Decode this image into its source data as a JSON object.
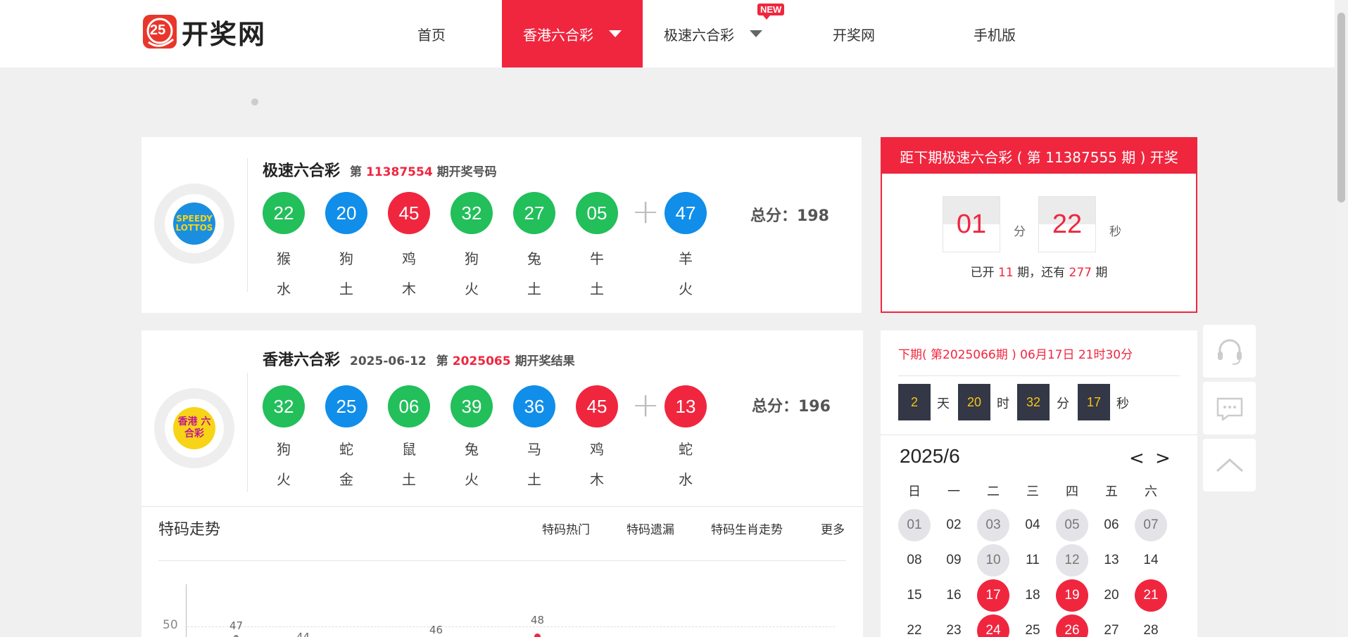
{
  "header": {
    "logo_text": "开奖网",
    "logo_mark": "25",
    "nav": [
      {
        "label": "首页"
      },
      {
        "label": "香港六合彩"
      },
      {
        "label": "极速六合彩"
      },
      {
        "label": "开奖网"
      },
      {
        "label": "手机版"
      }
    ],
    "new_badge": "NEW"
  },
  "speedy": {
    "name": "极速六合彩",
    "prefix": "第",
    "issue": "11387554",
    "suffix": "期开奖号码",
    "logo_text": "SPEEDY LOTTOS",
    "balls": [
      {
        "num": "22",
        "color": "green",
        "zodiac": "猴",
        "element": "水"
      },
      {
        "num": "20",
        "color": "blue",
        "zodiac": "狗",
        "element": "土"
      },
      {
        "num": "45",
        "color": "red",
        "zodiac": "鸡",
        "element": "木"
      },
      {
        "num": "32",
        "color": "green",
        "zodiac": "狗",
        "element": "火"
      },
      {
        "num": "27",
        "color": "green",
        "zodiac": "兔",
        "element": "土"
      },
      {
        "num": "05",
        "color": "green",
        "zodiac": "牛",
        "element": "土"
      }
    ],
    "special": {
      "num": "47",
      "color": "blue",
      "zodiac": "羊",
      "element": "火"
    },
    "total": "总分：198"
  },
  "hk": {
    "name": "香港六合彩",
    "date": "2025-06-12",
    "prefix": "第",
    "issue": "2025065",
    "suffix": "期开奖结果",
    "logo_text": "香港 六合彩",
    "balls": [
      {
        "num": "32",
        "color": "green",
        "zodiac": "狗",
        "element": "火"
      },
      {
        "num": "25",
        "color": "blue",
        "zodiac": "蛇",
        "element": "金"
      },
      {
        "num": "06",
        "color": "green",
        "zodiac": "鼠",
        "element": "土"
      },
      {
        "num": "39",
        "color": "green",
        "zodiac": "兔",
        "element": "火"
      },
      {
        "num": "36",
        "color": "blue",
        "zodiac": "马",
        "element": "土"
      },
      {
        "num": "45",
        "color": "red",
        "zodiac": "鸡",
        "element": "木"
      }
    ],
    "special": {
      "num": "13",
      "color": "red",
      "zodiac": "蛇",
      "element": "水"
    },
    "total": "总分：196"
  },
  "countdown": {
    "heading": "距下期极速六合彩 ( 第 11387555 期 ) 开奖",
    "minutes": "01",
    "min_unit": "分",
    "seconds": "22",
    "sec_unit": "秒",
    "info_pre": "已开",
    "opened": "11",
    "info_mid": "期，还有",
    "remaining": "277",
    "info_post": "期"
  },
  "hk_next": {
    "title": "下期( 第2025066期 ) 06月17日 21时30分",
    "days": "2",
    "day_unit": "天",
    "hours": "20",
    "hour_unit": "时",
    "minutes": "32",
    "min_unit": "分",
    "seconds": "17",
    "sec_unit": "秒"
  },
  "calendar": {
    "title": "2025/6",
    "prev": "<",
    "next": ">",
    "weekdays": [
      "日",
      "一",
      "二",
      "三",
      "四",
      "五",
      "六"
    ],
    "days": [
      {
        "d": "01",
        "s": "gray"
      },
      {
        "d": "02",
        "s": ""
      },
      {
        "d": "03",
        "s": "gray"
      },
      {
        "d": "04",
        "s": ""
      },
      {
        "d": "05",
        "s": "gray"
      },
      {
        "d": "06",
        "s": ""
      },
      {
        "d": "07",
        "s": "gray"
      },
      {
        "d": "08",
        "s": ""
      },
      {
        "d": "09",
        "s": ""
      },
      {
        "d": "10",
        "s": "gray"
      },
      {
        "d": "11",
        "s": ""
      },
      {
        "d": "12",
        "s": "gray"
      },
      {
        "d": "13",
        "s": ""
      },
      {
        "d": "14",
        "s": ""
      },
      {
        "d": "15",
        "s": ""
      },
      {
        "d": "16",
        "s": ""
      },
      {
        "d": "17",
        "s": "red"
      },
      {
        "d": "18",
        "s": ""
      },
      {
        "d": "19",
        "s": "red"
      },
      {
        "d": "20",
        "s": ""
      },
      {
        "d": "21",
        "s": "red"
      },
      {
        "d": "22",
        "s": ""
      },
      {
        "d": "23",
        "s": ""
      },
      {
        "d": "24",
        "s": "red"
      },
      {
        "d": "25",
        "s": ""
      },
      {
        "d": "26",
        "s": "red"
      },
      {
        "d": "27",
        "s": ""
      },
      {
        "d": "28",
        "s": ""
      }
    ]
  },
  "trend": {
    "title": "特码走势",
    "tabs": [
      "特码热门",
      "特码遗漏",
      "特码生肖走势",
      "更多"
    ],
    "y_tick": "50",
    "labels": [
      "47",
      "44",
      "46",
      "48"
    ]
  },
  "colors": {
    "brand_red": "#f0263f",
    "ball_green": "#22bf5a",
    "ball_blue": "#108ee9"
  }
}
